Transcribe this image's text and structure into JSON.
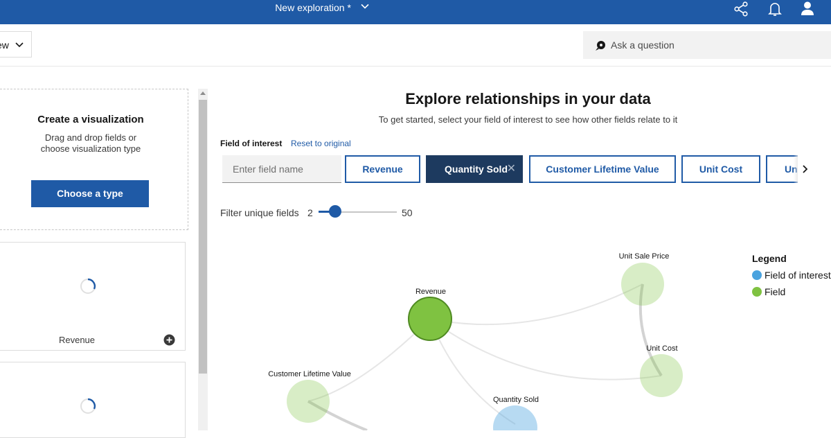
{
  "topbar": {
    "title": "New exploration *",
    "icons": [
      "chevron-down-icon",
      "share-icon",
      "notification-icon",
      "user-icon"
    ],
    "color": "#1f5aa6"
  },
  "subbar": {
    "view_label": "ew",
    "ask_placeholder": "Ask a question"
  },
  "left_panel": {
    "create_heading": "Create a visualization",
    "create_desc": "Drag and drop fields or choose visualization type",
    "choose_button": "Choose a type",
    "cards": [
      {
        "name": "Revenue",
        "loading": true
      },
      {
        "name": "",
        "loading": true
      }
    ]
  },
  "main": {
    "title": "Explore relationships in your data",
    "subtitle": "To get started, select your field of interest to see how other fields relate to it",
    "field_of_interest_label": "Field of interest",
    "reset_link": "Reset to original",
    "field_input_placeholder": "Enter field name",
    "chips": [
      {
        "label": "Revenue",
        "selected": false
      },
      {
        "label": "Quantity Sold",
        "selected": true
      },
      {
        "label": "Customer Lifetime Value",
        "selected": false
      },
      {
        "label": "Unit Cost",
        "selected": false
      },
      {
        "label": "Unit",
        "selected": false
      }
    ],
    "filter": {
      "label": "Filter unique fields",
      "min": "2",
      "max": "50",
      "value": 2
    }
  },
  "legend": {
    "title": "Legend",
    "items": [
      {
        "label": "Field of interest",
        "color": "#4aa3df"
      },
      {
        "label": "Field",
        "color": "#7fc241"
      }
    ]
  },
  "graph": {
    "nodes": [
      {
        "label": "Unit Sale Price",
        "kind": "field"
      },
      {
        "label": "Revenue",
        "kind": "field"
      },
      {
        "label": "Unit Cost",
        "kind": "field"
      },
      {
        "label": "Customer Lifetime Value",
        "kind": "field"
      },
      {
        "label": "Quantity Sold",
        "kind": "field-of-interest"
      }
    ]
  }
}
